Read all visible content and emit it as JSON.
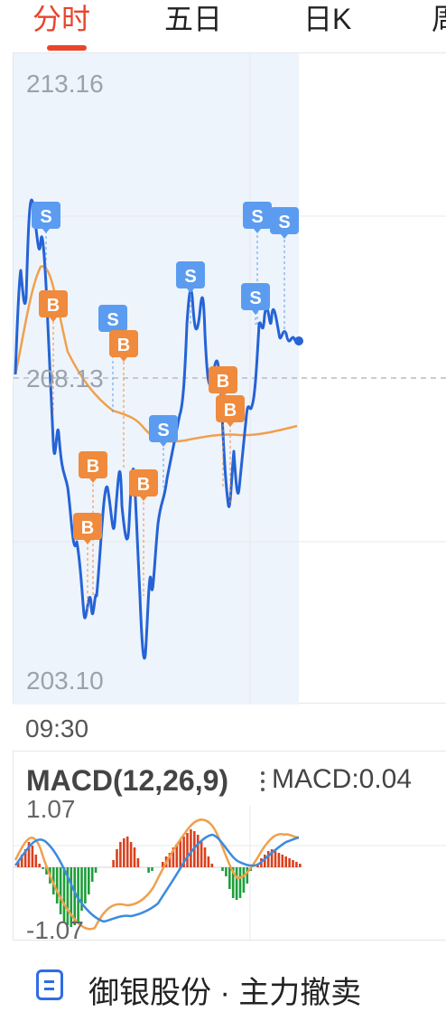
{
  "tabs": [
    {
      "label": "分时",
      "active": true
    },
    {
      "label": "五日",
      "active": false
    },
    {
      "label": "日K",
      "active": false
    },
    {
      "label": "周",
      "active": false
    }
  ],
  "price_chart": {
    "y_max_label": "213.16",
    "y_mid_label": "208.13",
    "y_min_label": "203.10",
    "x_start_label": "09:30"
  },
  "macd": {
    "title": "MACD(12,26,9)",
    "value_text": "MACD:0.04",
    "y_max_label": "1.07",
    "y_min_label": "-1.07"
  },
  "footer": {
    "text": "御银股份 · 主力撤卖"
  },
  "colors": {
    "accent": "#e8452c",
    "price_line": "#2563d6",
    "avg_line": "#f0a04b",
    "buy_marker": "#f08a3c",
    "sell_marker": "#5b9cf0",
    "macd_up": "#d9411e",
    "macd_down": "#1f9e3a"
  },
  "chart_data": [
    {
      "type": "line",
      "ylim": [
        203.1,
        213.16
      ],
      "reference": 208.13,
      "series": [],
      "markers": [
        {
          "type": "S"
        },
        {
          "type": "B"
        },
        {
          "type": "S"
        },
        {
          "type": "B"
        },
        {
          "type": "B"
        },
        {
          "type": "B"
        },
        {
          "type": "B"
        },
        {
          "type": "S"
        },
        {
          "type": "S"
        },
        {
          "type": "B"
        },
        {
          "type": "B"
        },
        {
          "type": "S"
        },
        {
          "type": "S"
        },
        {
          "type": "S"
        }
      ]
    },
    {
      "type": "bar",
      "title": "MACD(12,26,9)",
      "ylim": [
        -1.07,
        1.07
      ],
      "series": []
    }
  ]
}
